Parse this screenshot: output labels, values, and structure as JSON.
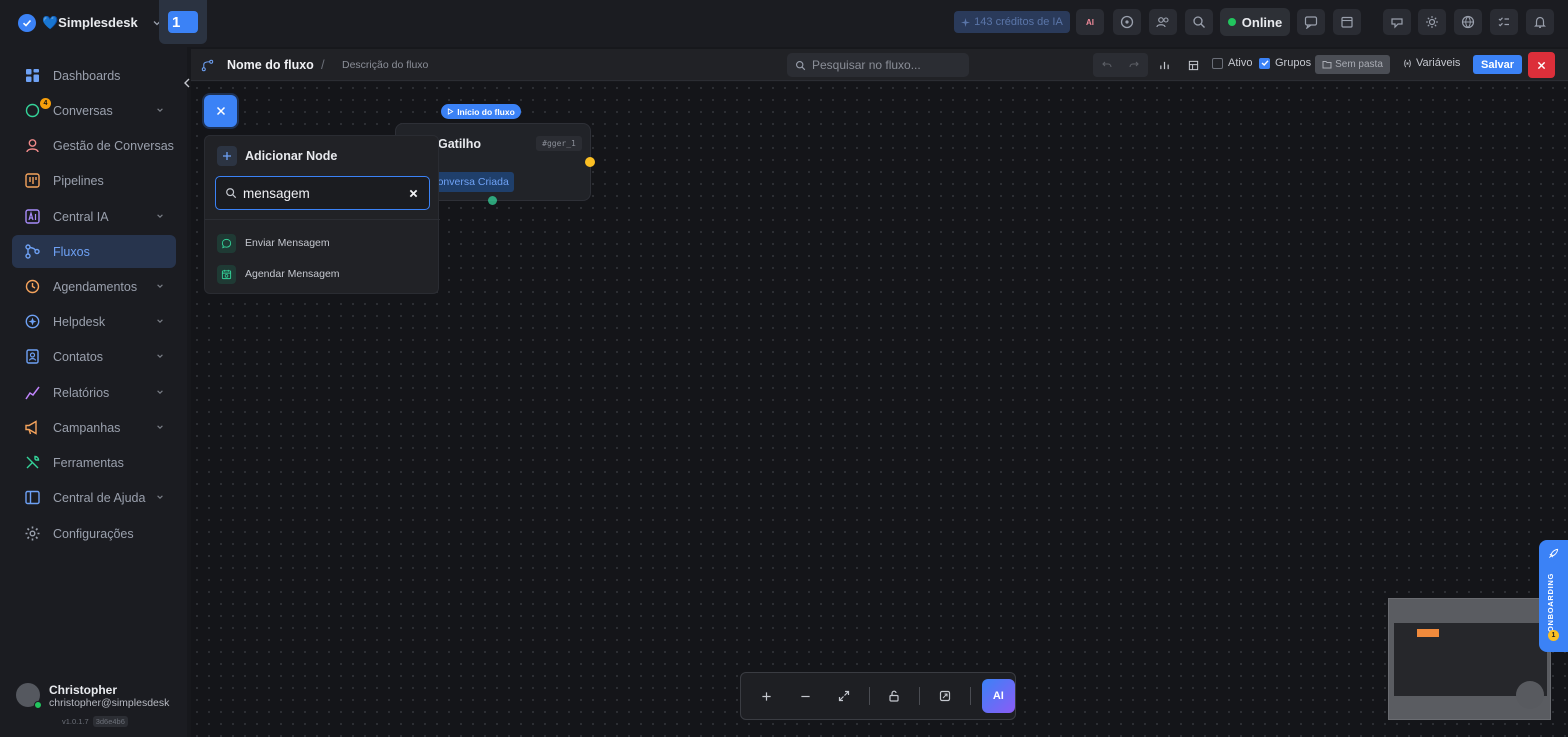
{
  "app": {
    "brand_name": "💙Simplesdesk",
    "workspace_badge": "1"
  },
  "topbar": {
    "credits_label": "143 créditos de IA",
    "status_label": "Online",
    "accent_color": "#3b82f6",
    "status_color": "#22c55e"
  },
  "sidebar": {
    "items": [
      {
        "label": "Dashboards",
        "icon": "dashboard-icon"
      },
      {
        "label": "Conversas",
        "icon": "chat-icon",
        "badge": "4",
        "has_submenu": true
      },
      {
        "label": "Gestão de Conversas",
        "icon": "headset-icon"
      },
      {
        "label": "Pipelines",
        "icon": "pipeline-icon"
      },
      {
        "label": "Central IA",
        "icon": "ai-icon",
        "has_submenu": true
      },
      {
        "label": "Fluxos",
        "icon": "flow-icon",
        "active": true
      },
      {
        "label": "Agendamentos",
        "icon": "calendar-icon",
        "has_submenu": true
      },
      {
        "label": "Helpdesk",
        "icon": "helpdesk-icon",
        "has_submenu": true
      },
      {
        "label": "Contatos",
        "icon": "contacts-icon",
        "has_submenu": true
      },
      {
        "label": "Relatórios",
        "icon": "chart-icon",
        "has_submenu": true
      },
      {
        "label": "Campanhas",
        "icon": "megaphone-icon",
        "has_submenu": true
      },
      {
        "label": "Ferramentas",
        "icon": "tools-icon"
      },
      {
        "label": "Central de Ajuda",
        "icon": "book-icon",
        "has_submenu": true
      },
      {
        "label": "Configurações",
        "icon": "gear-icon"
      }
    ],
    "user": {
      "name": "Christopher",
      "email": "christopher@simplesdesk",
      "version": "v1.0.1.7",
      "build": "3d6e4b6"
    }
  },
  "flow_header": {
    "name": "Nome do fluxo",
    "separator": "/",
    "description": "Descrição do fluxo",
    "search_placeholder": "Pesquisar no fluxo...",
    "active_label": "Ativo",
    "active_checked": false,
    "groups_label": "Grupos",
    "groups_checked": true,
    "folder_label": "Sem pasta",
    "variables_label": "Variáveis",
    "save_label": "Salvar"
  },
  "trigger_node": {
    "start_label": "Início do fluxo",
    "title": "Gatilho",
    "id": "#gger_1",
    "event": "Conversa Criada"
  },
  "add_node_panel": {
    "title": "Adicionar Node",
    "search_value": "mensagem",
    "results": [
      {
        "label": "Enviar Mensagem",
        "icon": "message-icon"
      },
      {
        "label": "Agendar Mensagem",
        "icon": "calendar-clock-icon"
      }
    ]
  },
  "bottom_toolbar": {
    "ai_label": "AI"
  },
  "onboarding": {
    "label": "ONBOARDING",
    "badge": "1"
  }
}
